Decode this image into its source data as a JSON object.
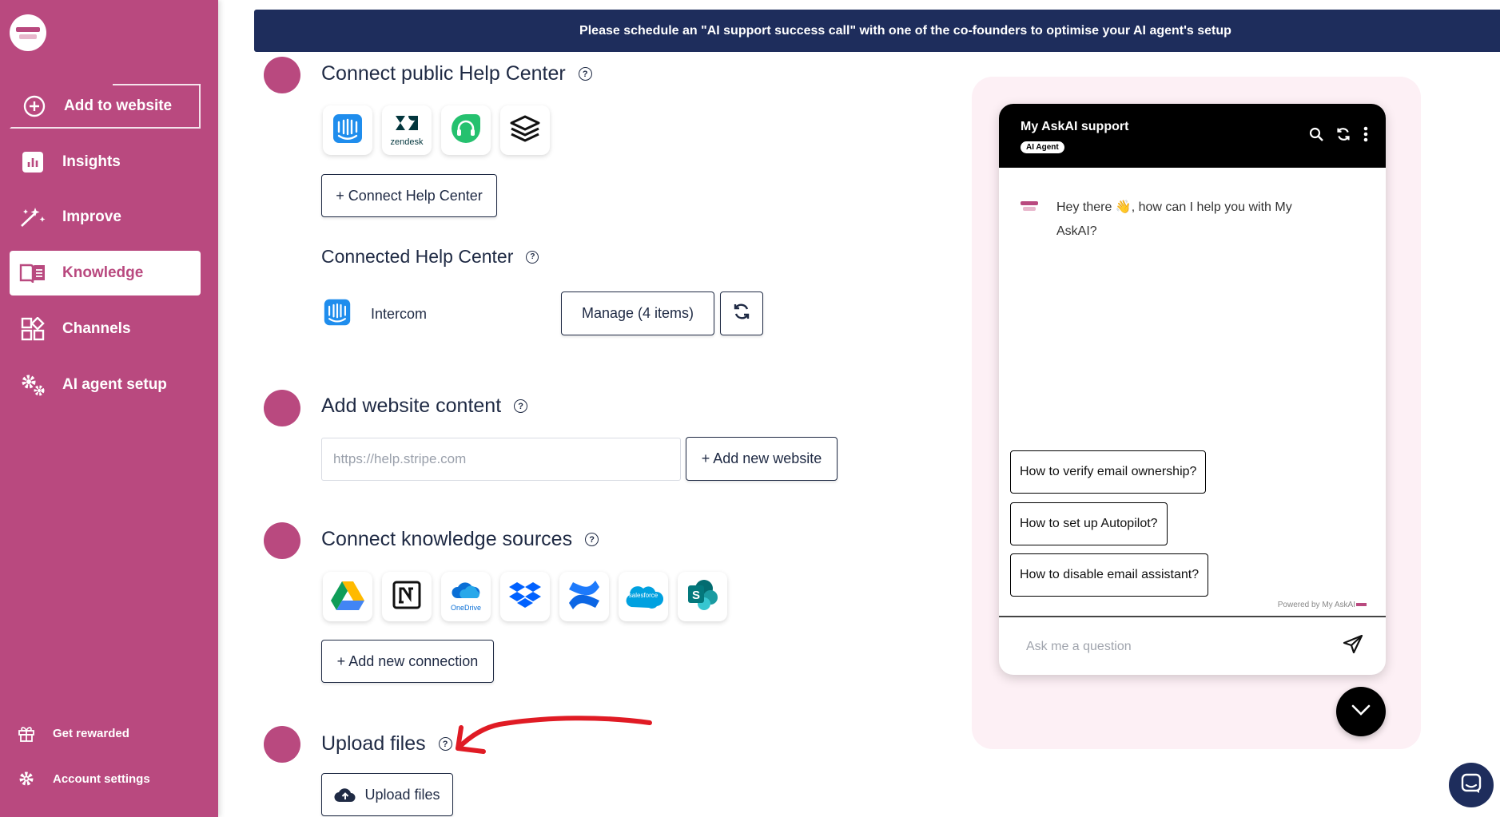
{
  "sidebar": {
    "items": [
      {
        "label": "Add to website",
        "icon": "plus-circle-icon"
      },
      {
        "label": "Insights",
        "icon": "bar-chart-icon"
      },
      {
        "label": "Improve",
        "icon": "sparkle-wand-icon"
      },
      {
        "label": "Knowledge",
        "icon": "book-icon",
        "active": true
      },
      {
        "label": "Channels",
        "icon": "grid-apps-icon"
      },
      {
        "label": "AI agent setup",
        "icon": "gears-icon"
      }
    ],
    "footer": [
      {
        "label": "Get rewarded",
        "icon": "gift-icon"
      },
      {
        "label": "Account settings",
        "icon": "gear-icon"
      }
    ],
    "accent_color": "#b9497f"
  },
  "banner": {
    "text": "Please schedule an \"AI support success call\" with one of the co-founders to optimise your AI agent's setup"
  },
  "sections": {
    "help_center": {
      "title": "Connect public Help Center",
      "providers": [
        "intercom",
        "zendesk",
        "freshdesk",
        "gitbook"
      ],
      "zendesk_label": "zendesk",
      "connect_button": "+ Connect Help Center"
    },
    "connected": {
      "title": "Connected Help Center",
      "name": "Intercom",
      "manage_button": "Manage (4 items)"
    },
    "website": {
      "title": "Add website content",
      "placeholder": "https://help.stripe.com",
      "add_button": "+ Add new website"
    },
    "sources": {
      "title": "Connect knowledge sources",
      "providers": [
        "google-drive",
        "notion",
        "onedrive",
        "dropbox",
        "confluence",
        "salesforce",
        "sharepoint"
      ],
      "onedrive_label": "OneDrive",
      "salesforce_label": "salesforce",
      "add_button": "+ Add new connection"
    },
    "upload": {
      "title": "Upload files",
      "button": "Upload files"
    }
  },
  "chat": {
    "title": "My AskAI support",
    "badge": "AI Agent",
    "greeting": "Hey there 👋, how can I help you with My AskAI?",
    "suggestions": [
      "How to verify email ownership?",
      "How to set up Autopilot?",
      "How to disable email assistant?"
    ],
    "powered_by": "Powered by My AskAI",
    "input_placeholder": "Ask me a question"
  },
  "colors": {
    "navy": "#1e2d5c",
    "annotation_arrow": "#e01b24"
  }
}
